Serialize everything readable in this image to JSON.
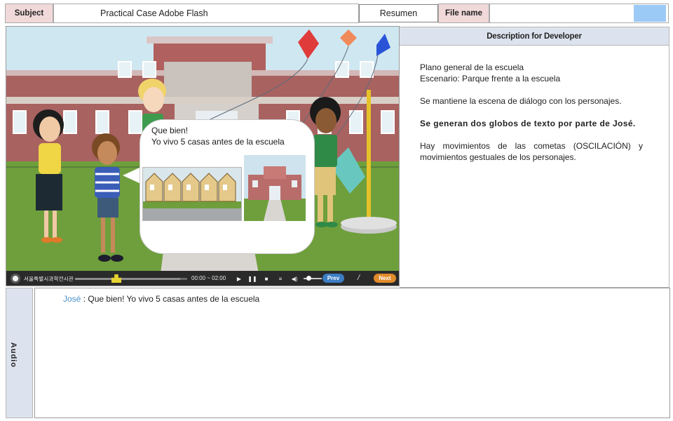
{
  "header": {
    "subject_label": "Subject",
    "subject_value": "Practical Case Adobe Flash",
    "resumen": "Resumen",
    "filename_label": "File name",
    "filename_value": ""
  },
  "scene": {
    "bubble_line1": "Que bien!",
    "bubble_line2": "Yo vivo 5 casas antes de la escuela",
    "player": {
      "org_text": "서울특별시과학전시관",
      "time": "00:00 ~ 02:00",
      "prev_label": "Prev",
      "separator": "/",
      "next_label": "Next",
      "progress": 0.94
    }
  },
  "description": {
    "header": "Description for Developer",
    "line1": "Plano general de la escuela",
    "line2": "Escenario: Parque frente a la escuela",
    "para2": "Se mantiene la escena de diálogo con los personajes.",
    "para3": "Se generan dos globos de texto por parte de José.",
    "para4": "Hay movimientos de las cometas (OSCILACIÓN) y movimientos gestuales de los personajes."
  },
  "audio": {
    "label": "Audio",
    "speaker": "José",
    "separator": " : ",
    "line": "Que bien! Yo vivo 5 casas antes de la escuela"
  },
  "colors": {
    "label_bg": "#f1d9d9",
    "panel_header_bg": "#dde3ee",
    "swatch": "#9ccaf6",
    "speaker": "#4a90c8",
    "prev_button": "#3b7dc4",
    "next_button": "#e08a2a"
  }
}
